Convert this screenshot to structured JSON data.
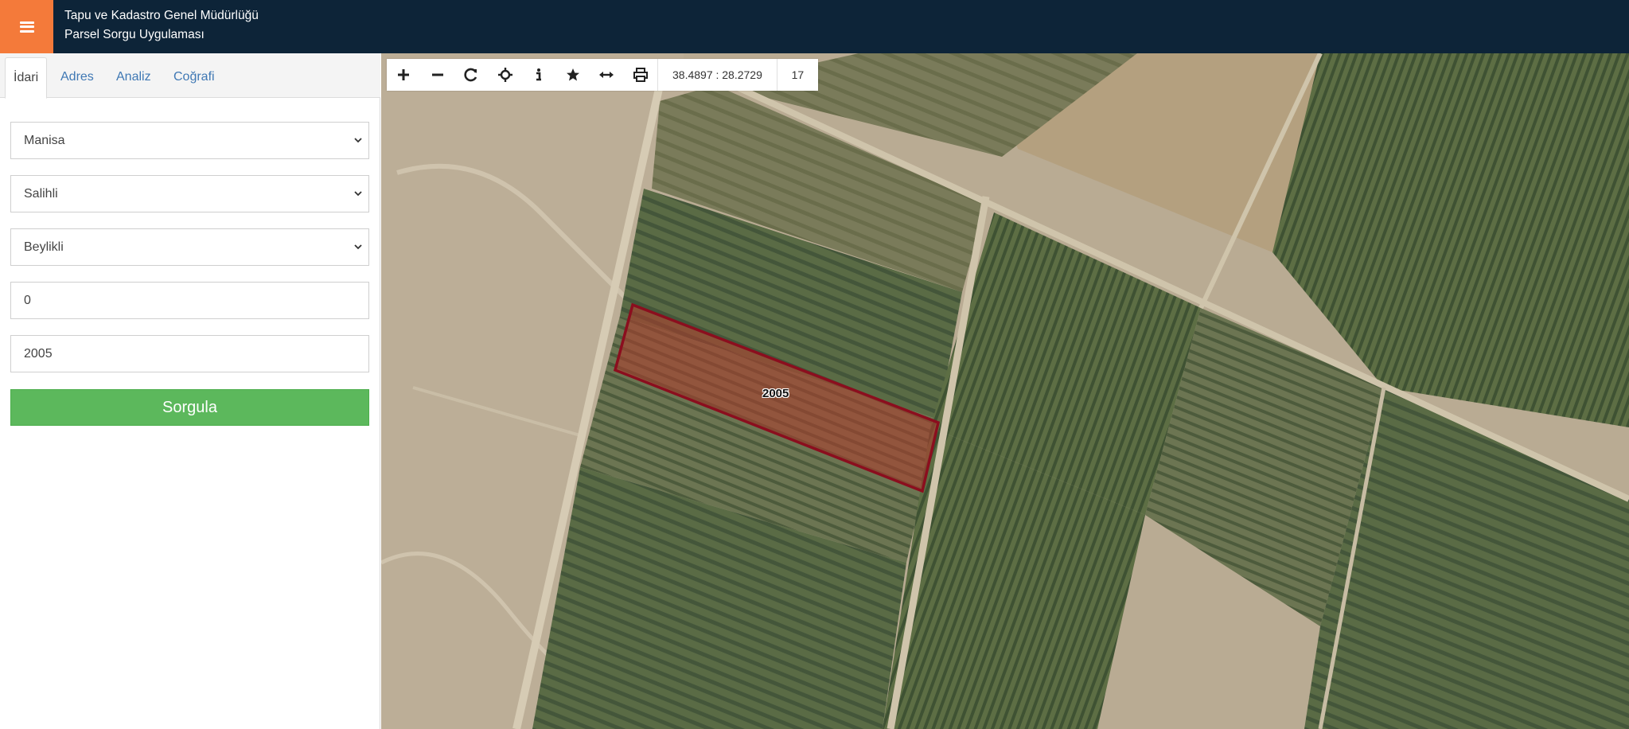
{
  "header": {
    "title_line1": "Tapu ve Kadastro Genel Müdürlüğü",
    "title_line2": "Parsel Sorgu Uygulaması",
    "menu_icon": "hamburger-icon",
    "colors": {
      "bar": "#0d2438",
      "menu": "#f47a3a"
    }
  },
  "sidebar": {
    "tabs": [
      {
        "label": "İdari",
        "active": true
      },
      {
        "label": "Adres",
        "active": false
      },
      {
        "label": "Analiz",
        "active": false
      },
      {
        "label": "Coğrafi",
        "active": false
      }
    ],
    "form": {
      "il": "Manisa",
      "ilce": "Salihli",
      "mahalle": "Beylikli",
      "ada": "0",
      "parsel": "2005",
      "submit_label": "Sorgula"
    },
    "colors": {
      "submit": "#5cb85c",
      "tab_link": "#3f78b4"
    }
  },
  "map": {
    "toolbar": {
      "icons": [
        "zoom-in-icon",
        "zoom-out-icon",
        "refresh-icon",
        "locate-icon",
        "info-icon",
        "favorite-icon",
        "measure-icon",
        "print-icon"
      ],
      "coordinates": "38.4897 : 28.2729",
      "zoom_level": "17"
    },
    "parcel_label": "2005",
    "parcel_color": "#8b0e1e"
  }
}
